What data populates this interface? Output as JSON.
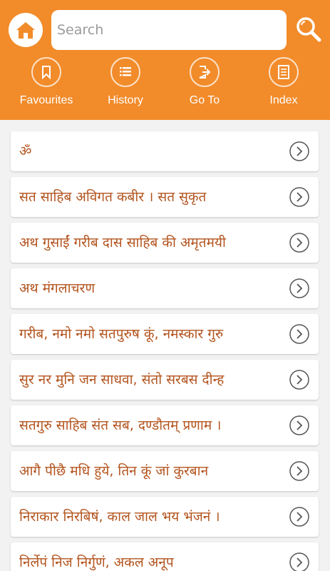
{
  "app": {
    "accent": "#f28b2a",
    "text_color": "#b3541e",
    "home_icon": "home-icon",
    "search_icon": "search-icon"
  },
  "search": {
    "placeholder": "Search",
    "value": ""
  },
  "tabs": [
    {
      "label": "Favourites",
      "icon": "bookmark-icon"
    },
    {
      "label": "History",
      "icon": "list-icon"
    },
    {
      "label": "Go To",
      "icon": "goto-icon"
    },
    {
      "label": "Index",
      "icon": "index-icon"
    }
  ],
  "items": [
    {
      "text": "ॐ"
    },
    {
      "text": "सत साहिब अविगत कबीर । सत सुकृत"
    },
    {
      "text": "अथ गुसाईं गरीब दास साहिब की अमृतमयी"
    },
    {
      "text": "अथ मंगलाचरण"
    },
    {
      "text": "गरीब, नमो नमो सतपुरुष कूं, नमस्कार गुरु"
    },
    {
      "text": "सुर नर मुनि जन साधवा, संतो सरबस दीन्ह"
    },
    {
      "text": "सतगुरु साहिब संत सब, दण्डौतम् प्रणाम ।"
    },
    {
      "text": "आगै पीछै मधि हुये, तिन कूं जां कुरबान"
    },
    {
      "text": "निराकार निरबिषं, काल जाल भय भंजनं ।"
    },
    {
      "text": "निर्लेपं निज निर्गुणं, अकल अनूप"
    }
  ]
}
